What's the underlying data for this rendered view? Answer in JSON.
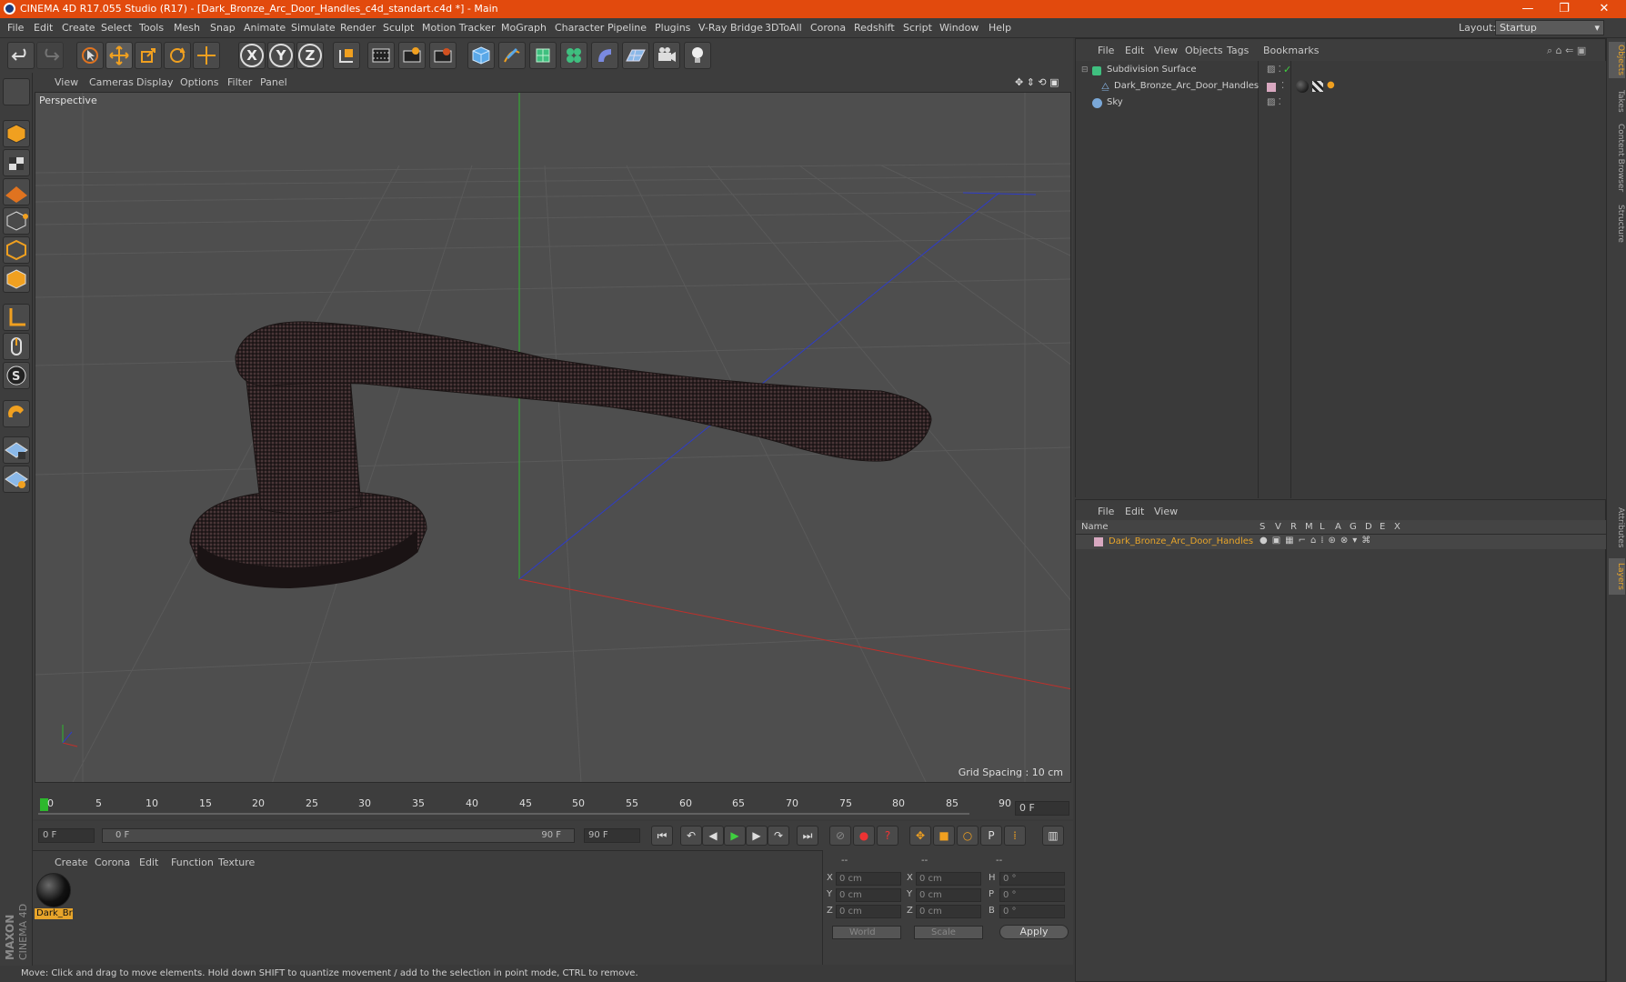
{
  "window": {
    "title": "CINEMA 4D R17.055 Studio (R17) - [Dark_Bronze_Arc_Door_Handles_c4d_standart.c4d *] - Main",
    "minimize": "—",
    "restore": "❐",
    "close": "✕"
  },
  "menu": [
    "File",
    "Edit",
    "Create",
    "Select",
    "Tools",
    "Mesh",
    "Snap",
    "Animate",
    "Simulate",
    "Render",
    "Sculpt",
    "Motion Tracker",
    "MoGraph",
    "Character",
    "Pipeline",
    "Plugins",
    "V-Ray Bridge",
    "3DToAll",
    "Corona",
    "Redshift",
    "Script",
    "Window",
    "Help"
  ],
  "layout": {
    "label": "Layout:",
    "value": "Startup"
  },
  "toolbar": {
    "axis_x": "X",
    "axis_y": "Y",
    "axis_z": "Z",
    "icons": [
      "undo-icon",
      "redo-icon",
      "select-arrow-icon",
      "move-icon",
      "scale-icon",
      "rotate-icon",
      "live-selection-icon",
      "axis-x-icon",
      "axis-y-icon",
      "axis-z-icon",
      "coordinate-system-icon",
      "render-view-icon",
      "render-picture-viewer-icon",
      "edit-render-settings-icon",
      "cube-icon",
      "pen-spline-icon",
      "subdivision-surface-icon",
      "cloner-icon",
      "deformer-icon",
      "floor-icon",
      "camera-icon",
      "light-icon"
    ]
  },
  "viewport": {
    "menu": [
      "View",
      "Cameras",
      "Display",
      "Options",
      "Filter",
      "Panel"
    ],
    "label": "Perspective",
    "grid_spacing": "Grid Spacing : 10 cm"
  },
  "timeline": {
    "ticks": [
      "0",
      "5",
      "10",
      "15",
      "20",
      "25",
      "30",
      "35",
      "40",
      "45",
      "50",
      "55",
      "60",
      "65",
      "70",
      "75",
      "80",
      "85",
      "90"
    ],
    "current_frame": "0 F"
  },
  "playback": {
    "start": "0 F",
    "range_start": "0 F",
    "range_end": "90 F",
    "end": "90 F"
  },
  "material_manager": {
    "menu": [
      "Create",
      "Corona",
      "Edit",
      "Function",
      "Texture"
    ],
    "material_name": "Dark_Br"
  },
  "coordinates": {
    "headers": [
      "--",
      "--",
      "--"
    ],
    "rows": [
      {
        "a": "X",
        "av": "0 cm",
        "b": "X",
        "bv": "0 cm",
        "c": "H",
        "cv": "0 °"
      },
      {
        "a": "Y",
        "av": "0 cm",
        "b": "Y",
        "bv": "0 cm",
        "c": "P",
        "cv": "0 °"
      },
      {
        "a": "Z",
        "av": "0 cm",
        "b": "Z",
        "bv": "0 cm",
        "c": "B",
        "cv": "0 °"
      }
    ],
    "world": "World",
    "scale": "Scale",
    "apply": "Apply"
  },
  "object_manager": {
    "menu": [
      "File",
      "Edit",
      "View",
      "Objects",
      "Tags",
      "Bookmarks"
    ],
    "objects": [
      "Subdivision Surface",
      "Dark_Bronze_Arc_Door_Handles",
      "Sky"
    ]
  },
  "layer_manager": {
    "menu": [
      "File",
      "Edit",
      "View"
    ],
    "columns": [
      "Name",
      "S",
      "V",
      "R",
      "M",
      "L",
      "A",
      "G",
      "D",
      "E",
      "X"
    ],
    "layer_name": "Dark_Bronze_Arc_Door_Handles"
  },
  "right_tabs": [
    "Objects",
    "Takes",
    "Content Browser",
    "Structure",
    "Attributes",
    "Layers"
  ],
  "status": "Move: Click and drag to move elements. Hold down SHIFT to quantize movement / add to the selection in point mode, CTRL to remove.",
  "logo": {
    "line1": "MAXON",
    "line2": "CINEMA 4D"
  },
  "colors": {
    "title_bar": "#e24a0d",
    "accent": "#e8a52a",
    "viewport_bg": "#4e4e4e"
  }
}
